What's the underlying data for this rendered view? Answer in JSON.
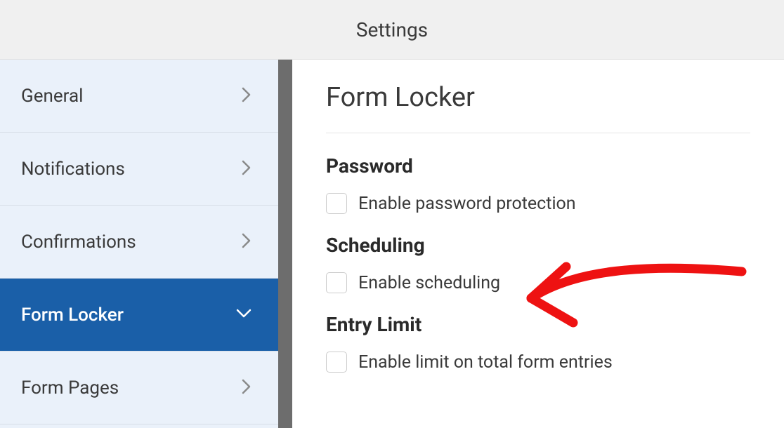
{
  "header": {
    "title": "Settings"
  },
  "sidebar": {
    "items": [
      {
        "label": "General",
        "active": false
      },
      {
        "label": "Notifications",
        "active": false
      },
      {
        "label": "Confirmations",
        "active": false
      },
      {
        "label": "Form Locker",
        "active": true
      },
      {
        "label": "Form Pages",
        "active": false
      }
    ]
  },
  "main": {
    "title": "Form Locker",
    "sections": [
      {
        "heading": "Password",
        "checkbox_label": "Enable password protection"
      },
      {
        "heading": "Scheduling",
        "checkbox_label": "Enable scheduling"
      },
      {
        "heading": "Entry Limit",
        "checkbox_label": "Enable limit on total form entries"
      }
    ]
  }
}
